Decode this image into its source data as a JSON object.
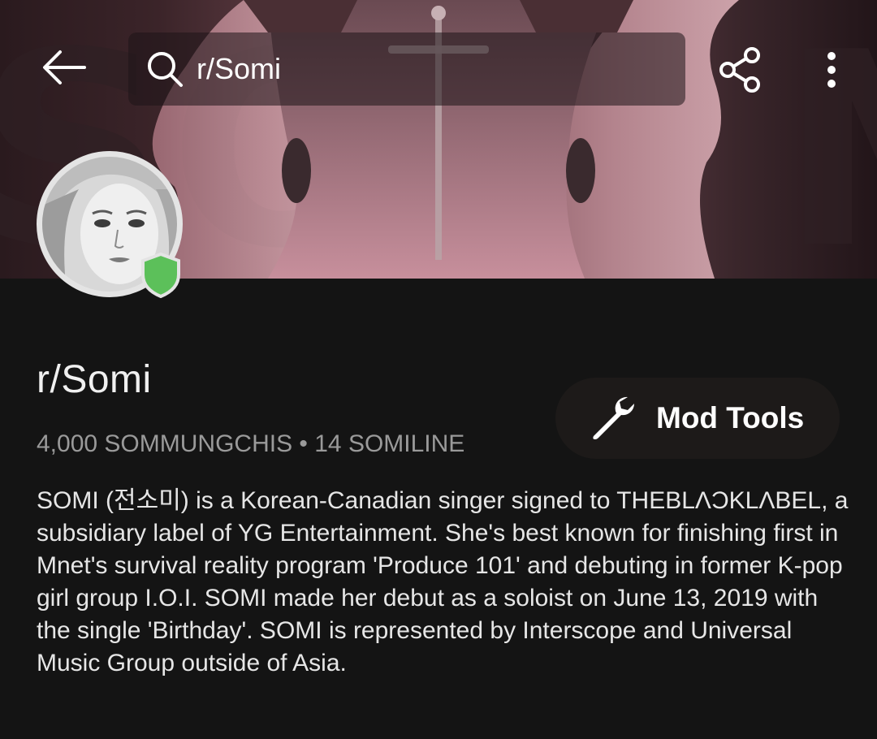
{
  "header": {
    "search_text": "r/Somi",
    "icons": {
      "back": "back-arrow-icon",
      "search": "search-icon",
      "share": "share-icon",
      "more": "more-vertical-icon"
    }
  },
  "community": {
    "name": "r/Somi",
    "stats": "4,000 SOMMUNGCHIS • 14 SOMILINE",
    "description": "SOMI (전소미) is a Korean-Canadian singer signed to THEBLΛƆKLΛBEL, a subsidiary label of YG Entertainment. She's best known for finishing first in Mnet's survival reality program 'Produce 101' and debuting in former K-pop girl group I.O.I. SOMI made her debut as a soloist on June 13, 2019 with the single 'Birthday'. SOMI is represented by Interscope and Universal Music Group outside of Asia.",
    "mod_badge_icon": "shield-icon"
  },
  "actions": {
    "mod_tools_label": "Mod Tools",
    "mod_tools_icon": "wrench-icon"
  },
  "colors": {
    "background": "#141414",
    "mod_badge": "#5cc05a",
    "button_bg": "#1d1a19"
  }
}
